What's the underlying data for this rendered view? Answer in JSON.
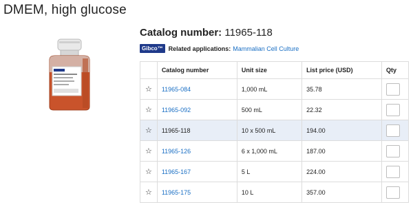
{
  "page": {
    "title": "DMEM, high glucose"
  },
  "catalog": {
    "label": "Catalog number:",
    "number": "11965-118"
  },
  "related": {
    "brand": "Gibco™",
    "label": "Related applications:",
    "link": "Mammalian Cell Culture"
  },
  "table": {
    "headers": {
      "star": "",
      "catalog": "Catalog number",
      "size": "Unit size",
      "price": "List price (USD)",
      "qty": "Qty"
    },
    "rows": [
      {
        "catalog": "11965-084",
        "size": "1,000 mL",
        "price": "35.78",
        "selected": false
      },
      {
        "catalog": "11965-092",
        "size": "500 mL",
        "price": "22.32",
        "selected": false
      },
      {
        "catalog": "11965-118",
        "size": "10 x 500 mL",
        "price": "194.00",
        "selected": true
      },
      {
        "catalog": "11965-126",
        "size": "6 x 1,000 mL",
        "price": "187.00",
        "selected": false
      },
      {
        "catalog": "11965-167",
        "size": "5 L",
        "price": "224.00",
        "selected": false
      },
      {
        "catalog": "11965-175",
        "size": "10 L",
        "price": "357.00",
        "selected": false
      }
    ]
  },
  "icons": {
    "favorite": "star-outline-icon"
  },
  "colors": {
    "link": "#1a6fc4",
    "brand_badge": "#1f3a8a",
    "selected_row": "#e8eef7"
  }
}
